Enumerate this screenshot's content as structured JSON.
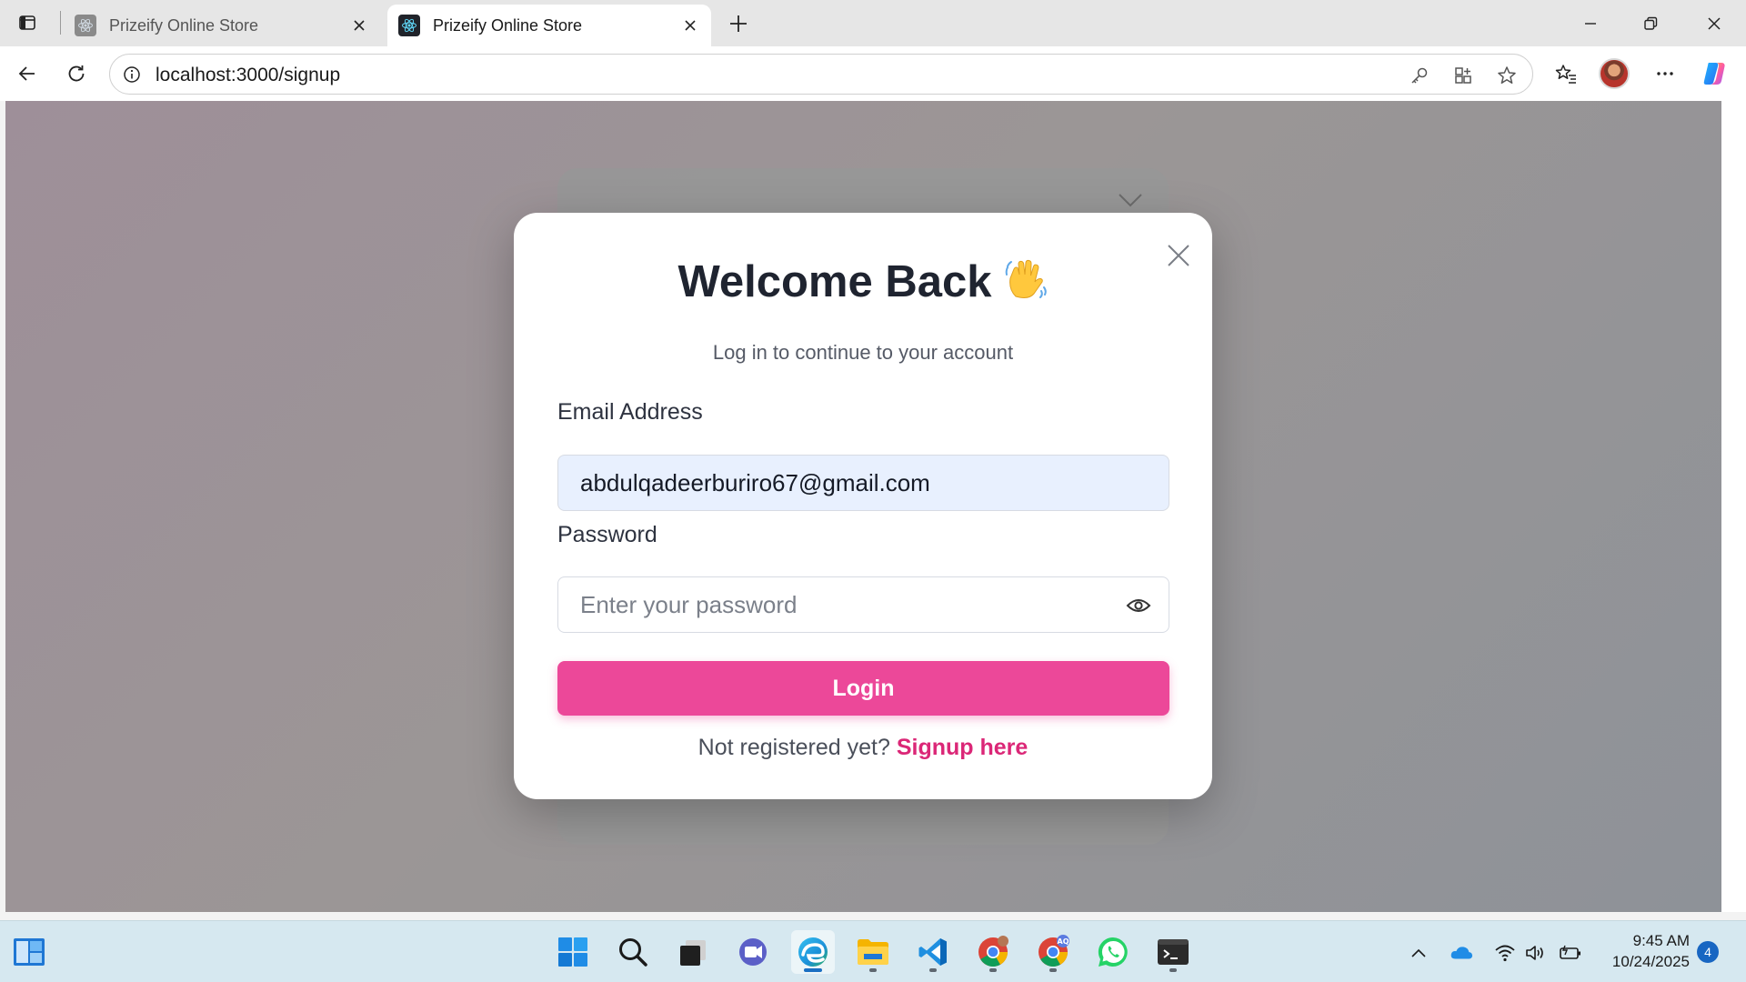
{
  "browser": {
    "tabs": [
      {
        "title": "Prizeify Online Store",
        "favicon": "react-icon",
        "active": false
      },
      {
        "title": "Prizeify Online Store",
        "favicon": "react-icon",
        "active": true
      }
    ],
    "url": "localhost:3000/signup"
  },
  "modal": {
    "title": "Welcome Back",
    "emoji": "👋",
    "subtitle": "Log in to continue to your account",
    "email_label": "Email Address",
    "email_value": "abdulqadeerburiro67@gmail.com",
    "password_label": "Password",
    "password_placeholder": "Enter your password",
    "login_label": "Login",
    "signup_prompt": "Not registered yet?",
    "signup_link": "Signup here",
    "accent_color": "#ec4899",
    "link_color": "#db2777"
  },
  "taskbar": {
    "apps": [
      "widgets-icon",
      "start-icon",
      "search-icon",
      "task-view-icon",
      "teams-icon",
      "edge-icon",
      "file-explorer-icon",
      "vscode-icon",
      "chrome-icon",
      "chrome-profile-icon",
      "whatsapp-icon",
      "terminal-icon"
    ],
    "chrome_profile_badge": "AQ",
    "time": "9:45 AM",
    "date": "10/24/2025",
    "notifications": "4"
  }
}
